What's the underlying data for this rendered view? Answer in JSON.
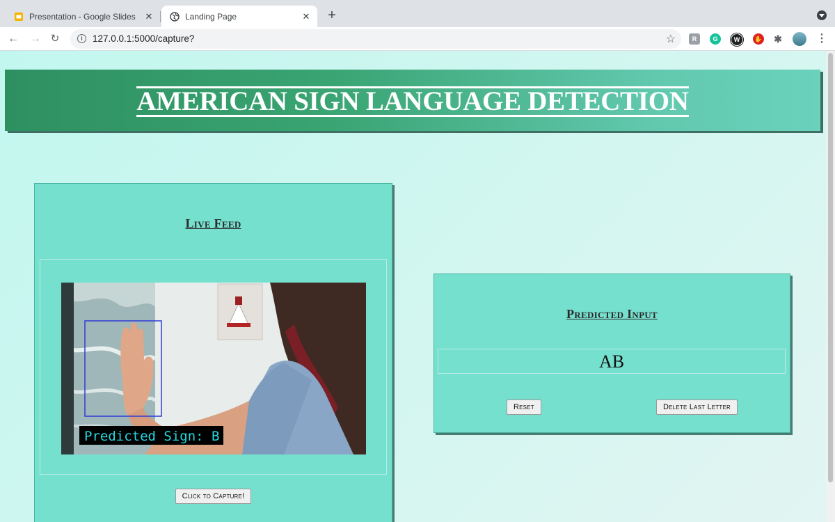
{
  "browser": {
    "tabs": [
      {
        "title": "Presentation - Google Slides",
        "active": false,
        "icon": "google-slides-icon"
      },
      {
        "title": "Landing Page",
        "active": true,
        "icon": "globe-icon"
      }
    ],
    "url": "127.0.0.1:5000/capture?",
    "extensions": [
      "custom-icon",
      "grammarly-icon",
      "w-icon",
      "stop-hand-icon",
      "puzzle-icon",
      "avatar"
    ]
  },
  "page": {
    "banner_title": "AMERICAN SIGN LANGUAGE DETECTION",
    "live_feed": {
      "title": "Live Feed",
      "video_overlay": "Predicted Sign: B",
      "capture_label": "Click to Capture!"
    },
    "predicted": {
      "title": "Predicted Input",
      "value": "AB",
      "reset_label": "Reset",
      "delete_label": "Delete Last Letter"
    }
  },
  "colors": {
    "banner_start": "#2e9060",
    "banner_end": "#6ad1bc",
    "card_bg": "#76e0cf",
    "page_bg": "#c2f7ef"
  }
}
